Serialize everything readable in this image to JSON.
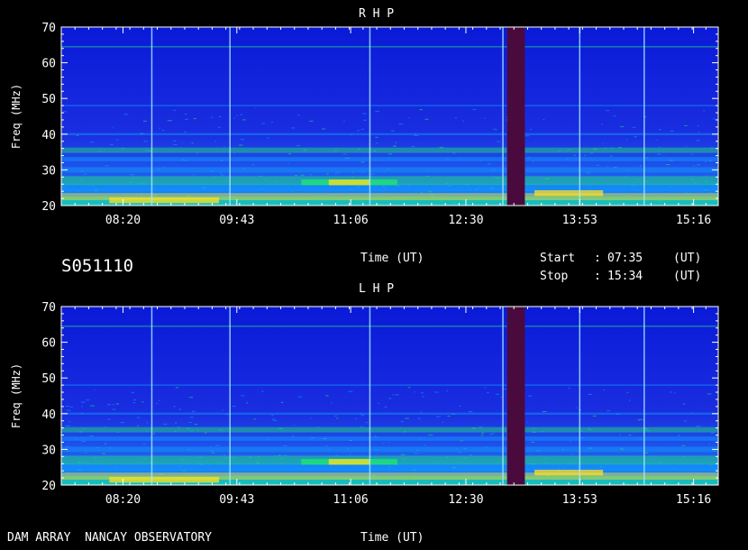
{
  "header": {
    "code": "S051110",
    "footer_left": "DAM ARRAY  NANCAY OBSERVATORY"
  },
  "time_info": {
    "start_label": "Start",
    "start_sep": ":",
    "start_value": "07:35",
    "start_unit": "(UT)",
    "stop_label": "Stop",
    "stop_sep": ":",
    "stop_value": "15:34",
    "stop_unit": "(UT)"
  },
  "chart_data": [
    {
      "type": "heatmap",
      "title": "R H P",
      "xlabel": "Time (UT)",
      "ylabel": "Freq (MHz)",
      "x_ticks": [
        "08:20",
        "09:43",
        "11:06",
        "12:30",
        "13:53",
        "15:16"
      ],
      "y_ticks": [
        20,
        30,
        40,
        50,
        60,
        70
      ],
      "ylim": [
        20,
        70
      ],
      "xlim": [
        "07:35",
        "15:34"
      ],
      "data_gap": [
        "13:00",
        "13:13"
      ],
      "colors": {
        "background": "#1a2ee0",
        "low": "#0a1ad8",
        "mid": "#10a0ff",
        "high": "#20e870",
        "peak": "#ffe020",
        "gap": "#4a0a3e"
      }
    },
    {
      "type": "heatmap",
      "title": "L H P",
      "xlabel": "Time (UT)",
      "ylabel": "Freq (MHz)",
      "x_ticks": [
        "08:20",
        "09:43",
        "11:06",
        "12:30",
        "13:53",
        "15:16"
      ],
      "y_ticks": [
        20,
        30,
        40,
        50,
        60,
        70
      ],
      "ylim": [
        20,
        70
      ],
      "xlim": [
        "07:35",
        "15:34"
      ],
      "data_gap": [
        "13:00",
        "13:13"
      ],
      "colors": {
        "background": "#1a2ee0",
        "low": "#0a1ad8",
        "mid": "#10a0ff",
        "high": "#20e870",
        "peak": "#ffe020",
        "gap": "#4a0a3e"
      }
    }
  ]
}
